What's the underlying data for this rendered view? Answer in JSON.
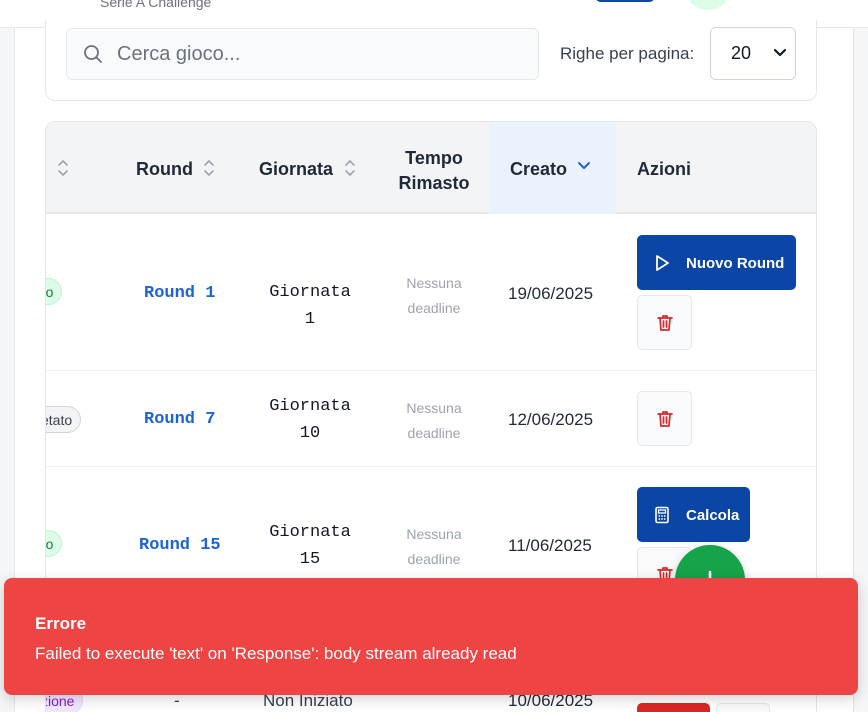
{
  "header": {
    "subtitle": "Serie A Challenge"
  },
  "filters": {
    "search_placeholder": "Cerca gioco...",
    "rows_label": "Righe per pagina:",
    "rows_value": "20"
  },
  "table": {
    "columns": {
      "round": "Round",
      "giornata": "Giornata",
      "tempo": "Tempo\nRimasto",
      "creato": "Creato",
      "azioni": "Azioni"
    },
    "rows": [
      {
        "status": "ro",
        "status_color": "green",
        "round": "Round 1",
        "giornata": "Giornata 1",
        "deadline": "Nessuna deadline",
        "created": "19/06/2025",
        "primary_action": "Nuovo Round"
      },
      {
        "status": "etato",
        "status_color": "gray",
        "round": "Round 7",
        "giornata": "Giornata 10",
        "deadline": "Nessuna deadline",
        "created": "12/06/2025",
        "primary_action": ""
      },
      {
        "status": "ro",
        "status_color": "green",
        "round": "Round 15",
        "giornata": "Giornata 15",
        "deadline": "Nessuna deadline",
        "created": "11/06/2025",
        "primary_action": "Calcola"
      },
      {
        "status": "zione",
        "status_color": "purple",
        "round": "-",
        "giornata": "",
        "deadline": "Non Iniziato",
        "created": "10/06/2025",
        "primary_action": ""
      }
    ]
  },
  "toast": {
    "title": "Errore",
    "message": "Failed to execute 'text' on 'Response': body stream already read"
  },
  "colors": {
    "primary": "#0b45a5",
    "link": "#1d63d8",
    "danger": "#ef4444",
    "success": "#16a34a"
  }
}
